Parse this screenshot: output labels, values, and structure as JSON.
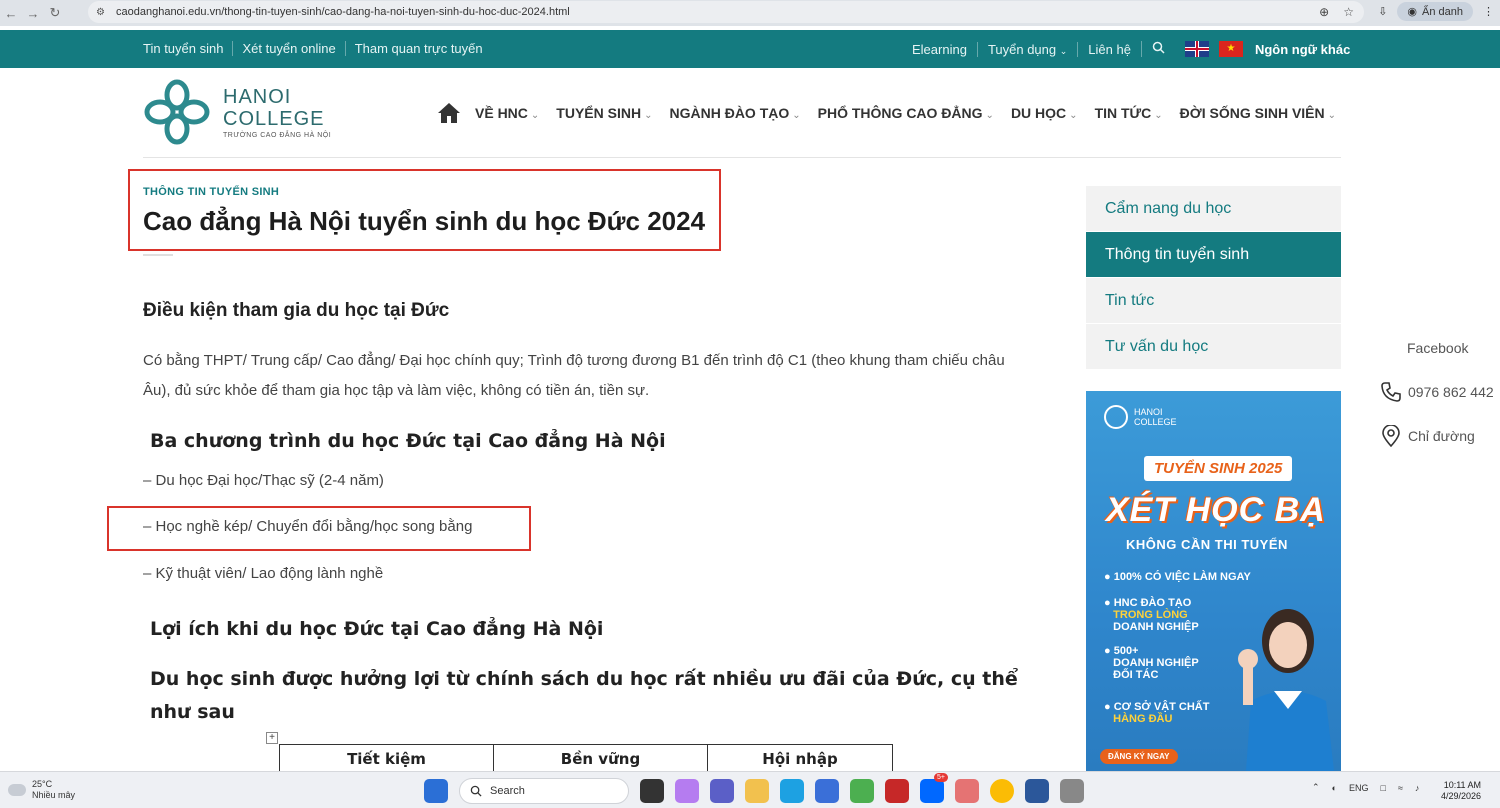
{
  "browser": {
    "url": "caodanghanoi.edu.vn/thong-tin-tuyen-sinh/cao-dang-ha-noi-tuyen-sinh-du-hoc-duc-2024.html",
    "profile_label": "Ẩn danh"
  },
  "topbar": {
    "left_links": [
      "Tin tuyển sinh",
      "Xét tuyển online",
      "Tham quan trực tuyến"
    ],
    "right_links": [
      "Elearning",
      "Tuyển dụng",
      "Liên hệ"
    ],
    "other_languages": "Ngôn ngữ khác"
  },
  "logo": {
    "line1": "HANOI",
    "line2": "COLLEGE",
    "tagline": "TRƯỜNG CAO ĐẲNG HÀ NỘI"
  },
  "main_nav": [
    "VỀ HNC",
    "TUYỂN SINH",
    "NGÀNH ĐÀO TẠO",
    "PHỔ THÔNG CAO ĐẲNG",
    "DU HỌC",
    "TIN TỨC",
    "ĐỜI SỐNG SINH VIÊN"
  ],
  "article": {
    "category": "THÔNG TIN TUYỂN SINH",
    "title": "Cao đẳng Hà Nội tuyển sinh du học Đức 2024",
    "h_conditions": "Điều kiện tham gia du học tại Đức",
    "p_conditions": "Có bằng THPT/ Trung cấp/ Cao đẳng/ Đại học chính quy; Trình độ tương đương B1 đến trình độ C1 (theo khung tham chiếu châu Âu), đủ sức khỏe để tham gia học tập và làm việc, không có tiền án, tiền sự.",
    "h_programs": "Ba chương trình du học Đức tại Cao đẳng Hà Nội",
    "programs": [
      "– Du học Đại học/Thạc sỹ (2-4 năm)",
      "– Học nghề kép/ Chuyển đổi bằng/học song bằng",
      "– Kỹ thuật viên/ Lao động lành nghề"
    ],
    "h_benefits": "Lợi ích khi du học Đức tại Cao đẳng Hà Nội",
    "h_policy": "Du học sinh được hưởng lợi từ chính sách du học rất nhiều ưu đãi của Đức, cụ thể như sau",
    "table_headers": [
      "Tiết kiệm",
      "Bền vững",
      "Hội nhập"
    ]
  },
  "sidebar": {
    "items": [
      "Cẩm nang du học",
      "Thông tin tuyển sinh",
      "Tin tức",
      "Tư vấn du học"
    ],
    "active_index": 1
  },
  "banner": {
    "logo_line1": "HANOI",
    "logo_line2": "COLLEGE",
    "tag": "TUYỂN SINH 2025",
    "headline": "XÉT HỌC BẠ",
    "sub": "KHÔNG CẦN THI TUYỂN",
    "bullet1": "100% CÓ VIỆC LÀM NGAY",
    "bullet2a": "HNC ĐÀO TẠO",
    "bullet2b": "TRONG LÒNG",
    "bullet2c": "DOANH NGHIỆP",
    "bullet3a": "500+",
    "bullet3b": "DOANH NGHIỆP",
    "bullet3c": "ĐỐI TÁC",
    "bullet4a": "CƠ SỞ VẬT CHẤT",
    "bullet4b": "HÀNG ĐẦU",
    "cta": "ĐĂNG KÝ NGAY"
  },
  "floating_contacts": {
    "facebook": "Facebook",
    "phone": "0976 862 442",
    "directions": "Chỉ đường"
  },
  "taskbar": {
    "temperature": "25°C",
    "weather": "Nhiều mây",
    "search_label": "Search",
    "language": "ENG",
    "time": "10:11 AM",
    "date": "4/29/2026",
    "zalo_badge": "5+"
  },
  "colors": {
    "teal": "#147b80",
    "highlight_red": "#d9342b",
    "banner_blue": "#2f86cc",
    "banner_orange": "#e8621a"
  }
}
